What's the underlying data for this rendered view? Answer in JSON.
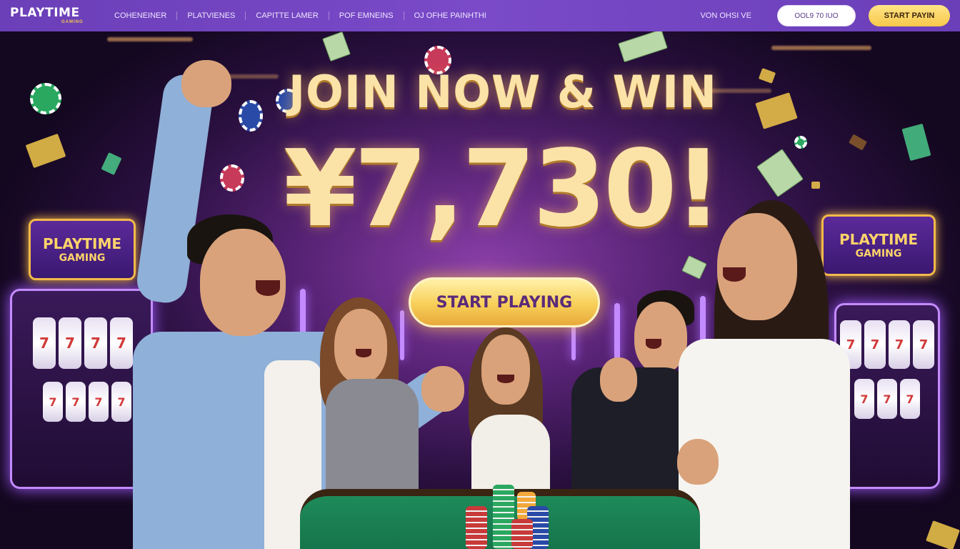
{
  "nav": {
    "logo_main": "PLAYTIME",
    "logo_sub": "GAMING",
    "links": [
      "COHENEINER",
      "PLATVIENES",
      "CAPITTE LAMER",
      "POF EMNEINS",
      "OJ OFHE PAINHTHI"
    ],
    "right_text": "VON OHSI VE",
    "outline_button": "OOL9 70 IUO",
    "start_button": "START PAYIN"
  },
  "hero": {
    "headline_line1": "JOIN NOW & WIN",
    "headline_line2": "¥7,730!",
    "cta_label": "START PLAYING",
    "left_sign_line1": "PLAYTIME",
    "left_sign_line2": "GAMING",
    "right_sign_line1": "PLAYTIME",
    "right_sign_line2": "GAMING"
  },
  "colors": {
    "nav_bg": "#7a4ac9",
    "accent_gold": "#f7c84a",
    "headline": "#fbe3a8",
    "table_green": "#1e8a5a"
  }
}
